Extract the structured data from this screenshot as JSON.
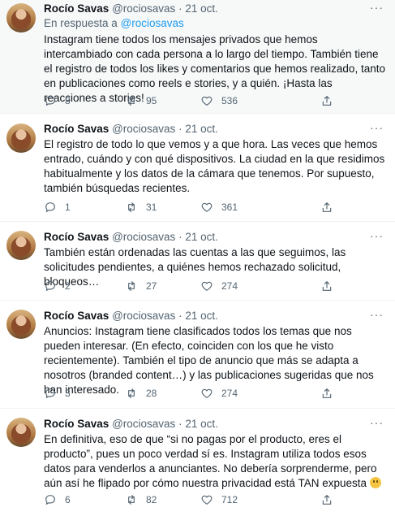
{
  "tweets": [
    {
      "name": "Rocío Savas",
      "handle": "@rociosavas",
      "dot": "·",
      "date": "21 oct.",
      "reply_prefix": "En respuesta a",
      "reply_to": "@rociosavas",
      "text": "Instagram tiene todos los mensajes privados que hemos intercambiado con cada persona a lo largo del tiempo. También tiene el registro de todos los likes y comentarios que hemos realizado, tanto en publicaciones como reels e stories, y a quién. ¡Hasta las reacciones a stories!",
      "replies": "8",
      "retweets": "95",
      "likes": "536"
    },
    {
      "name": "Rocío Savas",
      "handle": "@rociosavas",
      "dot": "·",
      "date": "21 oct.",
      "text": "El registro de todo lo que vemos y a que hora. Las veces que hemos entrado, cuándo y con qué dispositivos. La ciudad en la que residimos habitualmente y los datos de la cámara que tenemos. Por supuesto, también búsquedas recientes.",
      "replies": "1",
      "retweets": "31",
      "likes": "361"
    },
    {
      "name": "Rocío Savas",
      "handle": "@rociosavas",
      "dot": "·",
      "date": "21 oct.",
      "text": "También están ordenadas las cuentas a las que seguimos, las solicitudes pendientes, a quiénes hemos rechazado solicitud, bloqueos…",
      "replies": "2",
      "retweets": "27",
      "likes": "274"
    },
    {
      "name": "Rocío Savas",
      "handle": "@rociosavas",
      "dot": "·",
      "date": "21 oct.",
      "text": "Anuncios: Instagram tiene clasificados todos los temas que nos pueden interesar. (En efecto, coinciden con los que he visto recientemente). También el tipo de anuncio que más se adapta a nosotros (branded content…) y las publicaciones sugeridas que nos han interesado.",
      "replies": "3",
      "retweets": "28",
      "likes": "274"
    },
    {
      "name": "Rocío Savas",
      "handle": "@rociosavas",
      "dot": "·",
      "date": "21 oct.",
      "text": "En definitiva, eso de que “si no pagas por el producto, eres el producto”, pues un poco verdad sí es. Instagram utiliza todos esos datos para venderlos a anunciantes. No debería sorprenderme, pero aún así he flipado por cómo nuestra privacidad está TAN expuesta",
      "replies": "6",
      "retweets": "82",
      "likes": "712"
    }
  ],
  "more_glyph": "···",
  "icons": {
    "reply": "reply-icon",
    "retweet": "retweet-icon",
    "like": "heart-icon",
    "share": "share-icon",
    "more": "more-icon",
    "emoji": "upside-down-face-emoji"
  }
}
